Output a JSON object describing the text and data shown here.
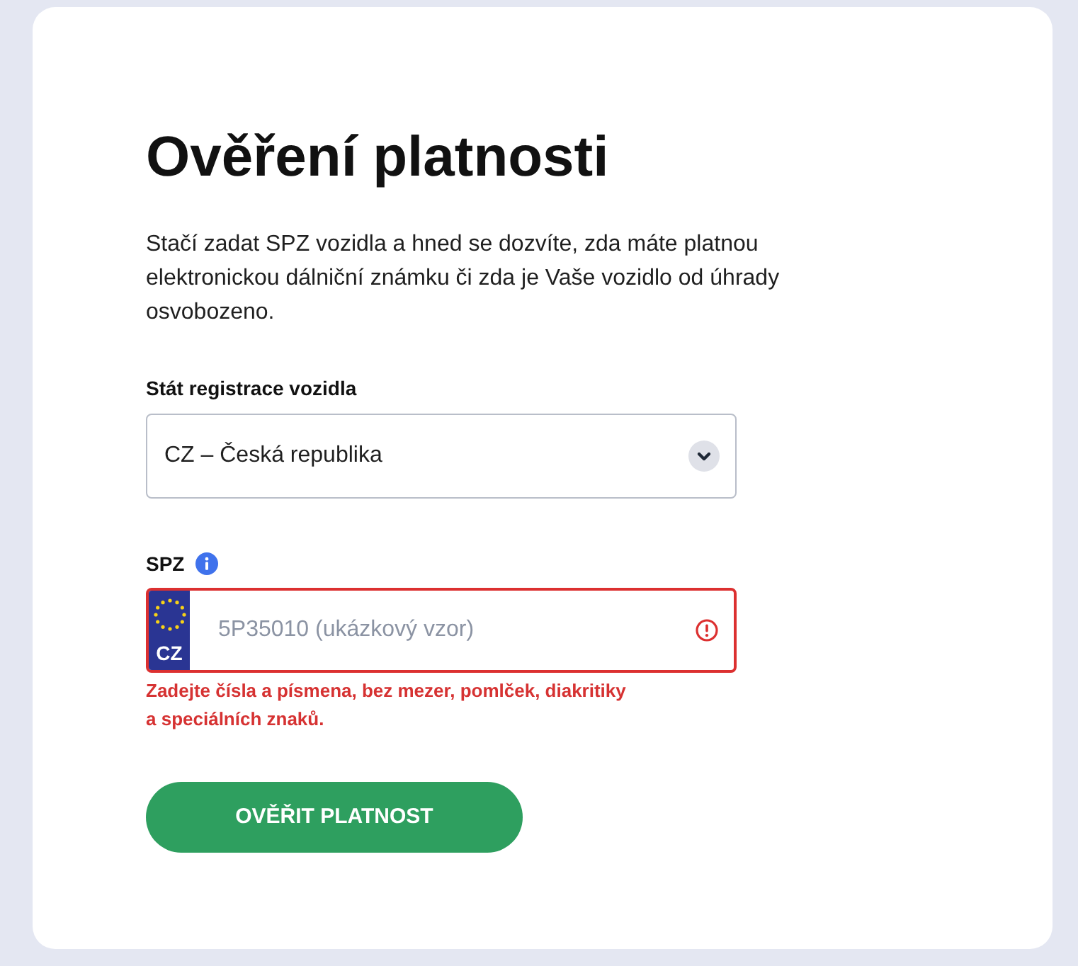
{
  "card": {
    "title": "Ověření platnosti",
    "description": "Stačí zadat SPZ vozidla a hned se dozvíte, zda máte platnou elektronickou dálniční známku či zda je Vaše vozidlo od úhrady osvobozeno.",
    "country_field": {
      "label": "Stát registrace vozidla",
      "value": "CZ – Česká republika"
    },
    "plate_field": {
      "label": "SPZ",
      "country_code": "CZ",
      "placeholder": "5P35010 (ukázkový vzor)",
      "invalid": true,
      "error": "Zadejte čísla a písmena, bez mezer, pomlček, diakritiky a speciálních znaků."
    },
    "submit_button": "OVĚŘIT PLATNOST"
  }
}
